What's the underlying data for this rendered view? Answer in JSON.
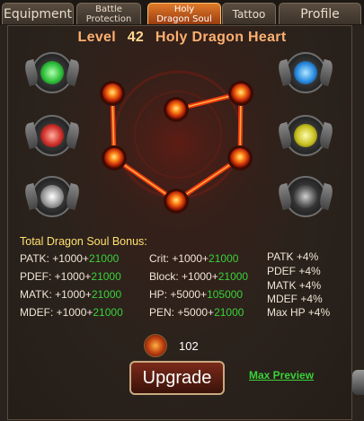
{
  "tabs": [
    {
      "label": "Equipment"
    },
    {
      "label_line1": "Battle",
      "label_line2": "Protection"
    },
    {
      "label_line1": "Holy",
      "label_line2": "Dragon Soul"
    },
    {
      "label": "Tattoo"
    },
    {
      "label": "Profile"
    }
  ],
  "header": {
    "level_label": "Level",
    "level_value": "42",
    "name": "Holy Dragon Heart"
  },
  "bonus": {
    "heading": "Total Dragon Soul Bonus:",
    "col1": [
      {
        "label": "PATK: +1000+",
        "value": "21000"
      },
      {
        "label": "PDEF: +1000+",
        "value": "21000"
      },
      {
        "label": "MATK: +1000+",
        "value": "21000"
      },
      {
        "label": "MDEF: +1000+",
        "value": "21000"
      }
    ],
    "col2": [
      {
        "label": "Crit: +1000+",
        "value": "21000"
      },
      {
        "label": "Block: +1000+",
        "value": "21000"
      },
      {
        "label": "HP: +5000+",
        "value": "105000"
      },
      {
        "label": "PEN: +5000+",
        "value": "21000"
      }
    ],
    "col3": [
      "PATK +4%",
      "PDEF +4%",
      "MATK +4%",
      "MDEF +4%",
      "Max HP +4%"
    ]
  },
  "soul": {
    "count": "102"
  },
  "actions": {
    "upgrade_label": "Upgrade",
    "max_preview_label": "Max Preview"
  },
  "runes": [
    {
      "name": "wind-rune-icon",
      "color": "#2fbf3a"
    },
    {
      "name": "fire-rune-icon",
      "color": "#d0302a"
    },
    {
      "name": "steel-rune-icon",
      "color": "#9a9a9a"
    },
    {
      "name": "water-rune-icon",
      "color": "#2a8ae0"
    },
    {
      "name": "thunder-rune-icon",
      "color": "#c8c020"
    },
    {
      "name": "dark-rune-icon",
      "color": "#5a5a5a"
    }
  ],
  "colors": {
    "accent": "#ffb070",
    "bonus_green": "#39d239",
    "node_glow": "#ff5010"
  }
}
